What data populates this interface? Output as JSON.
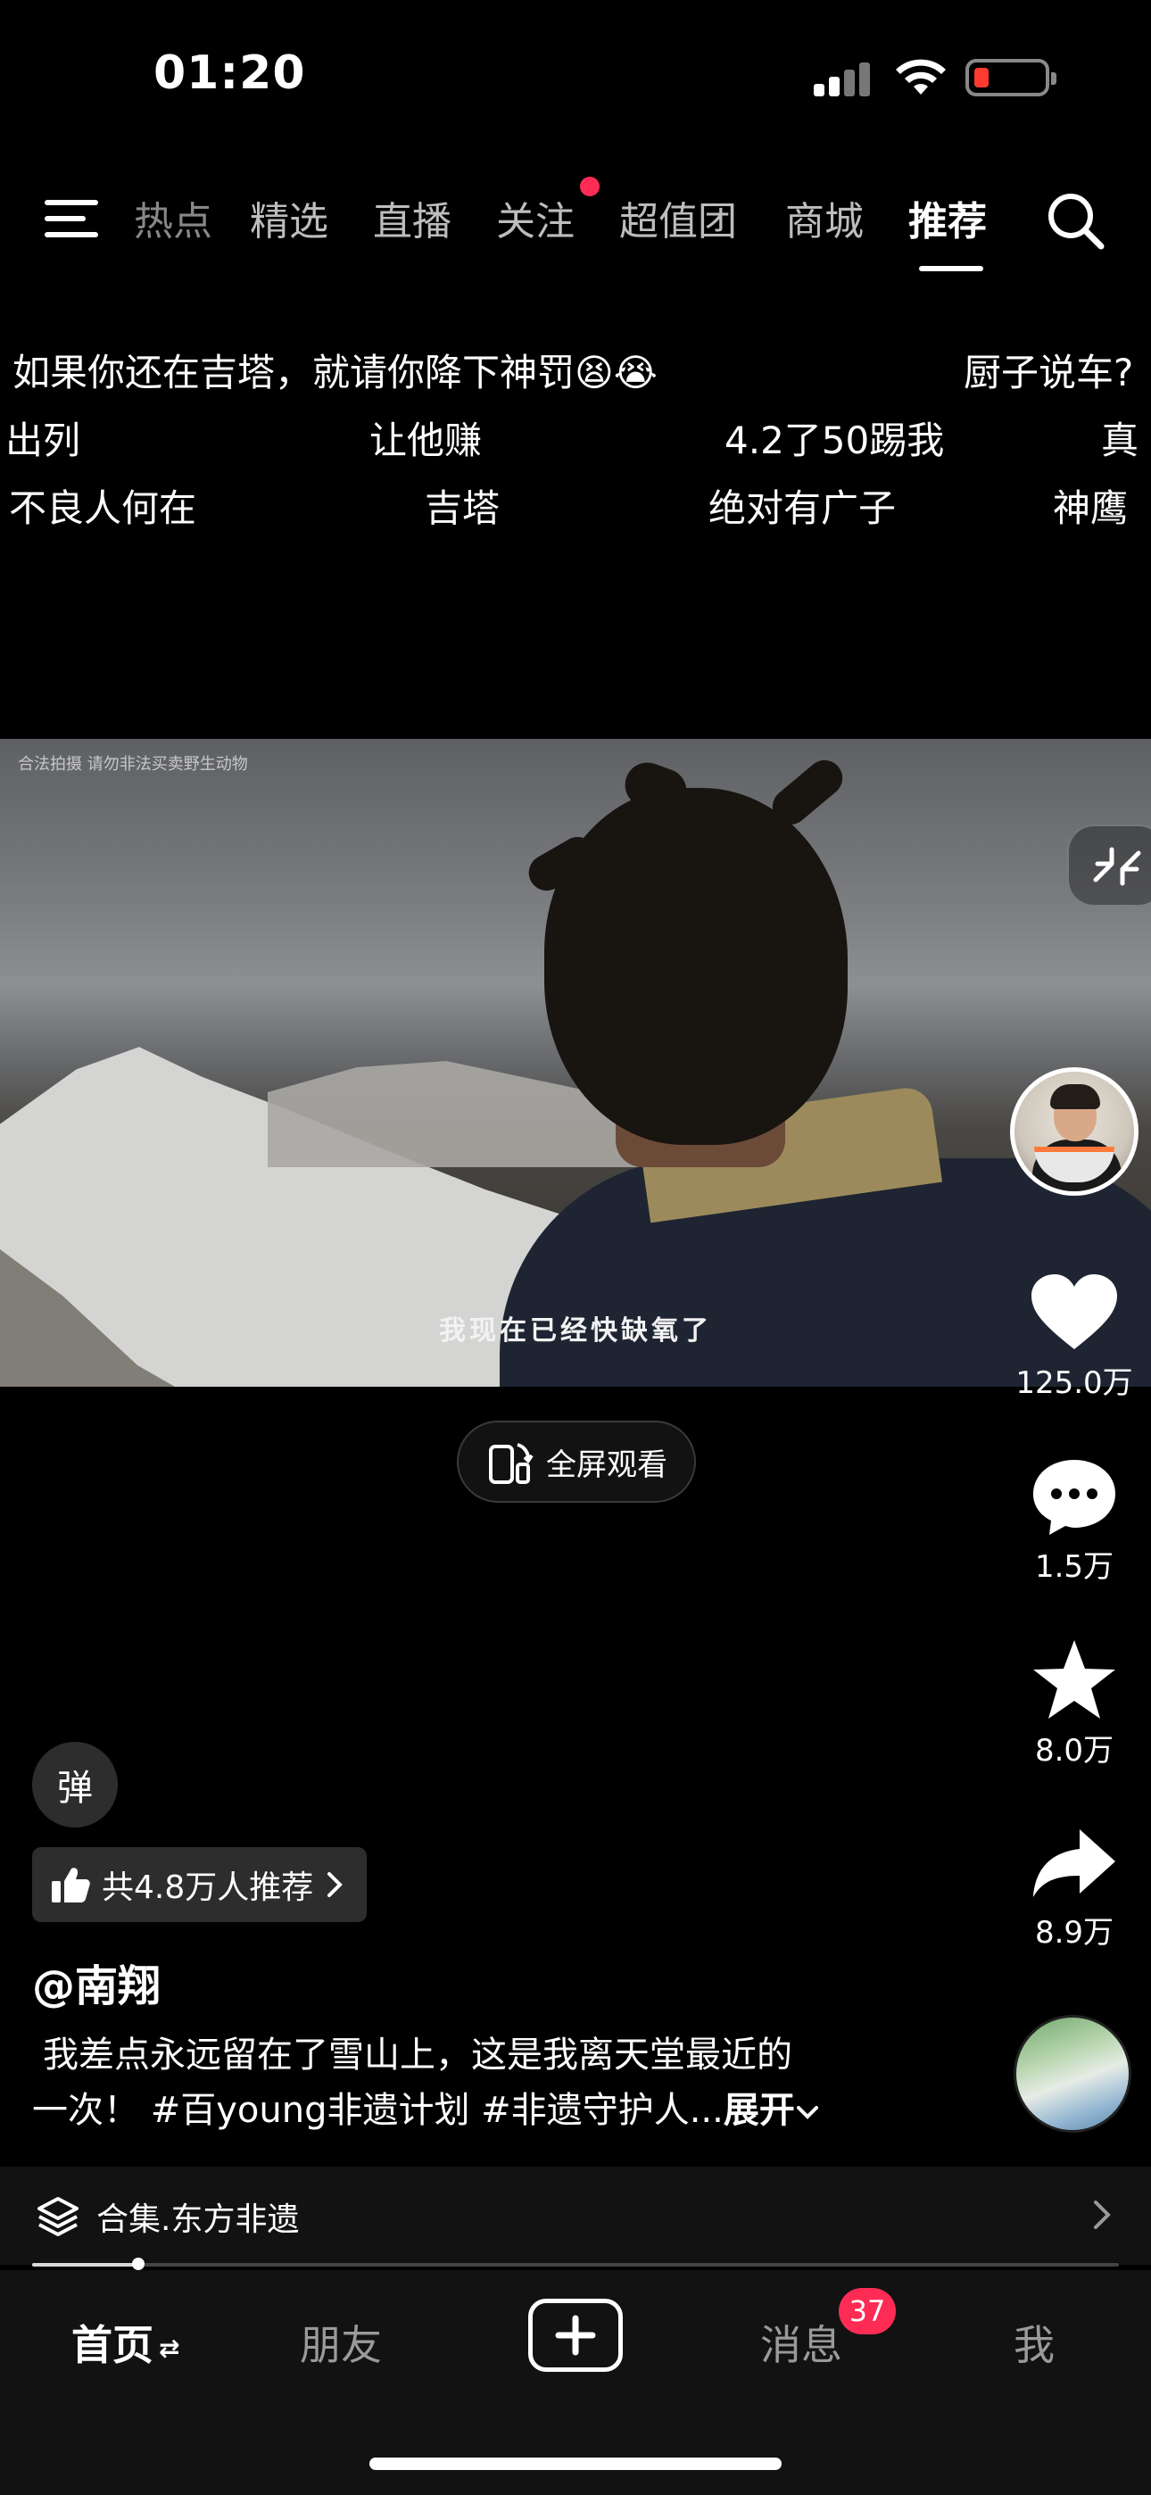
{
  "status_bar": {
    "time": "01:20"
  },
  "top_nav": {
    "tabs": [
      {
        "label": "热点",
        "active": false
      },
      {
        "label": "精选",
        "active": false
      },
      {
        "label": "直播",
        "active": false
      },
      {
        "label": "关注",
        "active": false,
        "dot": true
      },
      {
        "label": "超值团",
        "active": false
      },
      {
        "label": "商城",
        "active": false
      },
      {
        "label": "推荐",
        "active": true
      }
    ]
  },
  "danmaku": [
    "如果你还在吉塔，就请你降下神罚😫😭",
    "厨子说车?",
    "出列",
    "让他赚",
    "4.2了50踢我",
    "真",
    "不良人何在",
    "吉塔",
    "绝对有广子",
    "神鹰"
  ],
  "video": {
    "watermark": "合法拍摄 请勿非法买卖野生动物",
    "subtitle": "我现在已经快缺氧了"
  },
  "fullscreen_label": "全屏观看",
  "rail": {
    "likes": "125.0万",
    "comments": "1.5万",
    "favorites": "8.0万",
    "shares": "8.9万"
  },
  "danmu_toggle_label": "弹",
  "recommend_label": "共4.8万人推荐",
  "author": "@南翔",
  "description": {
    "line1": "我差点永远留在了雪山上，这是我离天堂最近的",
    "line2": "一次！ #百young非遗计划 #非遗守护人...",
    "expand": "展开"
  },
  "collection": {
    "label": "合集.东方非遗",
    "progress": 0.098
  },
  "bottom_nav": {
    "home": "首页",
    "friends": "朋友",
    "messages": "消息",
    "messages_badge": "37",
    "me": "我"
  },
  "colors": {
    "accent": "#fe2c55",
    "background": "#000000"
  }
}
